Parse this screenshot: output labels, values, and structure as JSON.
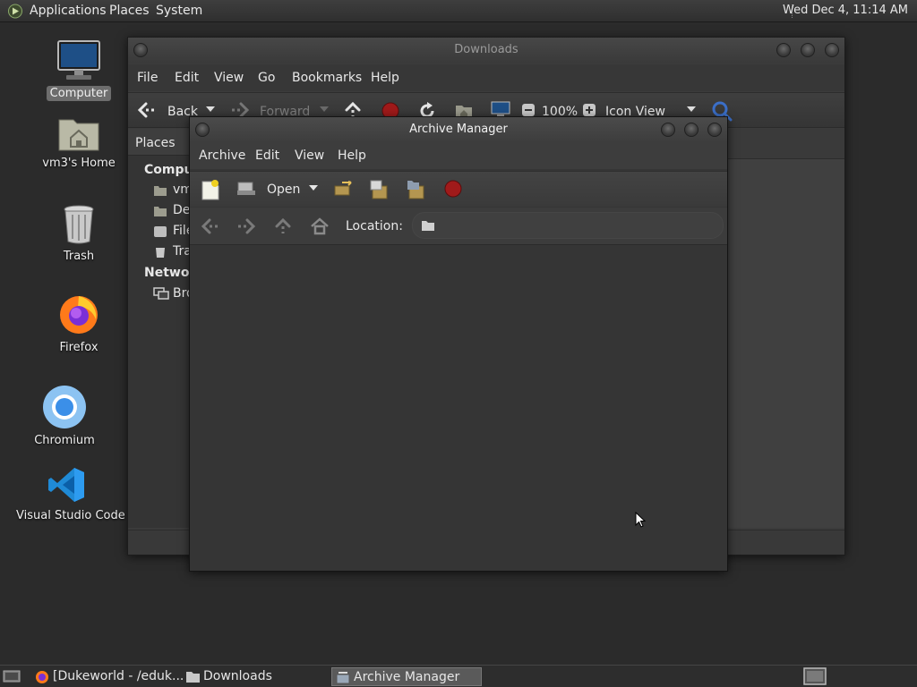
{
  "top_panel": {
    "menus": [
      "Applications",
      "Places",
      "System"
    ],
    "clock": "Wed Dec  4, 11:14 AM"
  },
  "desktop_icons": [
    {
      "label": "Computer",
      "icon": "computer-icon",
      "selected": true
    },
    {
      "label": "vm3's Home",
      "icon": "home-folder-icon"
    },
    {
      "label": "Trash",
      "icon": "trash-icon"
    },
    {
      "label": "Firefox",
      "icon": "firefox-icon"
    },
    {
      "label": "Chromium",
      "icon": "chromium-icon"
    },
    {
      "label": "Visual Studio Code",
      "icon": "vscode-icon"
    }
  ],
  "downloads_window": {
    "title": "Downloads",
    "menus": [
      "File",
      "Edit",
      "View",
      "Go",
      "Bookmarks",
      "Help"
    ],
    "toolbar": {
      "back": "Back",
      "forward": "Forward",
      "zoom": "100%",
      "view_mode": "Icon View"
    },
    "sidebar": {
      "header": "Places",
      "section_computer": "Comput",
      "items": [
        "vm",
        "De",
        "File",
        "Tra"
      ],
      "section_network": "Network",
      "network_items": [
        "Bro"
      ]
    }
  },
  "archive_window": {
    "title": "Archive Manager",
    "menus": [
      "Archive",
      "Edit",
      "View",
      "Help"
    ],
    "toolbar": {
      "open": "Open"
    },
    "location_label": "Location:"
  },
  "taskbar": {
    "tasks": [
      "[Dukeworld - /eduk...",
      "Downloads",
      "Archive Manager"
    ],
    "active_task": "Archive Manager"
  },
  "colors": {
    "stop_red": "#a01a1a",
    "accent_blue": "#3b8fe8"
  }
}
